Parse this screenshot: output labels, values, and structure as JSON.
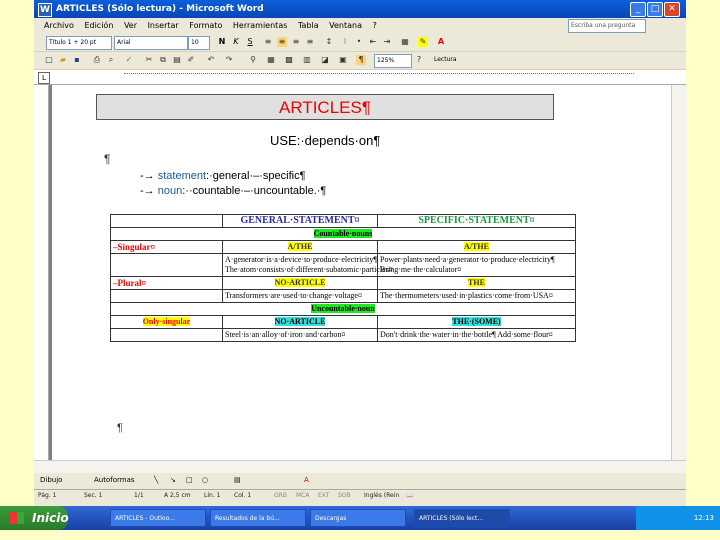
{
  "window": {
    "title": "ARTICLES (Sólo lectura) - Microsoft Word",
    "app_icon": "W",
    "buttons": [
      "_",
      "□",
      "✕"
    ]
  },
  "menu": [
    "Archivo",
    "Edición",
    "Ver",
    "Insertar",
    "Formato",
    "Herramientas",
    "Tabla",
    "Ventana",
    "?"
  ],
  "help_box": {
    "placeholder": "Escriba una pregunta"
  },
  "toolbar": {
    "style": "Título 1 + 20 pt",
    "font": "Arial",
    "size": "10",
    "zoom": "125%",
    "read_button": "Lectura"
  },
  "document": {
    "title": "ARTICLES¶",
    "use_line": "USE:·depends·on¶",
    "pilcrow": "¶",
    "bullet1_keyword": "statement",
    "bullet1_rest": ":·general·–·specific¶",
    "bullet2_keyword": "noun",
    "bullet2_rest": ":··countable·–·uncountable.·¶",
    "end_mark": "¶",
    "table": {
      "h_general": "GENERAL·STATEMENT¤",
      "h_specific": "SPECIFIC·STATEMENT¤",
      "countable": "Countable·nouns",
      "singular_label": "–Singular¤",
      "a_the": "A/THE",
      "sing_general": "A·generator·is·a·device·to·produce·electricity¶ The·atom·consists·of·different·subatomic·particles¤",
      "sing_specific": "Power·plants·need·a·generator·to·produce·electricity¶ Bring·me·the·calculator¤",
      "plural_label": "–Plural¤",
      "no_article": "NO·ARTICLE",
      "the": "THE",
      "plur_general": "Transformers·are·used·to·change·voltage¤",
      "plur_specific": "The·thermometers·used·in·plastics·come·from·USA¤",
      "uncountable": "Uncountable·noun",
      "only_singular": "Only·singular",
      "the_some": "THE·(SOME)",
      "unc_general": "Steel·is·an·alloy·of·iron·and·carbon¤",
      "unc_specific": "Don't·drink·the·water·in·the·bottle¶ Add·some·flour¤"
    }
  },
  "drawbar": {
    "draw": "Dibujo",
    "autoshapes": "Autoformas"
  },
  "status": [
    "Pág. 1",
    "Sec. 1",
    "1/1",
    "A 2,5 cm",
    "Lín. 1",
    "Col. 1",
    "GRB",
    "MCA",
    "EXT",
    "SOB",
    "Inglés (Rein"
  ],
  "taskbar": {
    "start": "Inicio",
    "tasks": [
      "ARTICLES - Outloo...",
      "Resultados de la bú...",
      "Descargas",
      "ARTICLES (Sólo lect..."
    ],
    "clock": "12:13"
  }
}
